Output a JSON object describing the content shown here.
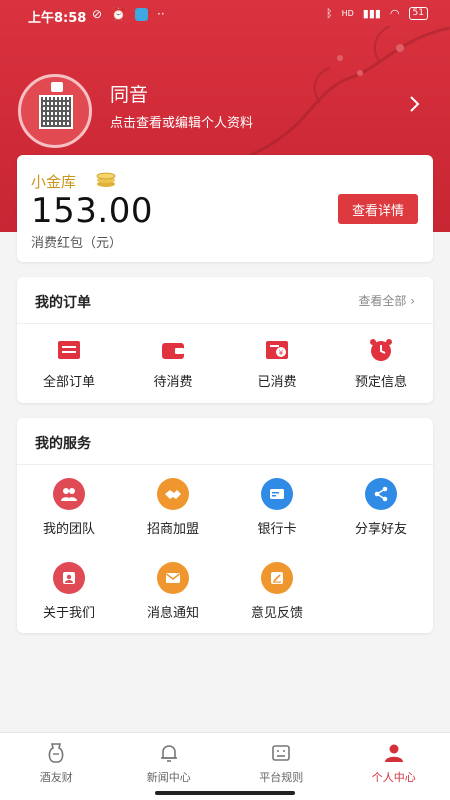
{
  "status": {
    "time": "上午8:58",
    "battery": "51",
    "network": "HD"
  },
  "profile": {
    "nickname": "同音",
    "subtitle": "点击查看或编辑个人资料"
  },
  "wallet": {
    "title": "小金库",
    "amount": "153.00",
    "caption": "消费红包（元）",
    "detail_button": "查看详情"
  },
  "orders": {
    "title": "我的订单",
    "view_all": "查看全部 ›",
    "items": [
      {
        "label": "全部订单",
        "icon": "order-list-icon"
      },
      {
        "label": "待消费",
        "icon": "wallet-icon"
      },
      {
        "label": "已消费",
        "icon": "consumed-icon"
      },
      {
        "label": "预定信息",
        "icon": "alarm-clock-icon"
      }
    ]
  },
  "services": {
    "title": "我的服务",
    "items": [
      {
        "label": "我的团队",
        "icon": "team-icon",
        "color": "#e04a55"
      },
      {
        "label": "招商加盟",
        "icon": "handshake-icon",
        "color": "#f0962e"
      },
      {
        "label": "银行卡",
        "icon": "bank-card-icon",
        "color": "#2f8be6"
      },
      {
        "label": "分享好友",
        "icon": "share-icon",
        "color": "#2f8be6"
      },
      {
        "label": "关于我们",
        "icon": "about-icon",
        "color": "#e04a55"
      },
      {
        "label": "消息通知",
        "icon": "message-icon",
        "color": "#f0962e"
      },
      {
        "label": "意见反馈",
        "icon": "feedback-icon",
        "color": "#f0962e"
      }
    ]
  },
  "tabbar": {
    "items": [
      {
        "label": "酒友财",
        "icon": "wine-jar-icon",
        "active": false
      },
      {
        "label": "新闻中心",
        "icon": "bell-icon",
        "active": false
      },
      {
        "label": "平台规则",
        "icon": "rules-icon",
        "active": false
      },
      {
        "label": "个人中心",
        "icon": "person-icon",
        "active": true
      }
    ]
  },
  "colors": {
    "primary": "#d3303a",
    "gold": "#c8961b",
    "button": "#dc3a3f"
  }
}
